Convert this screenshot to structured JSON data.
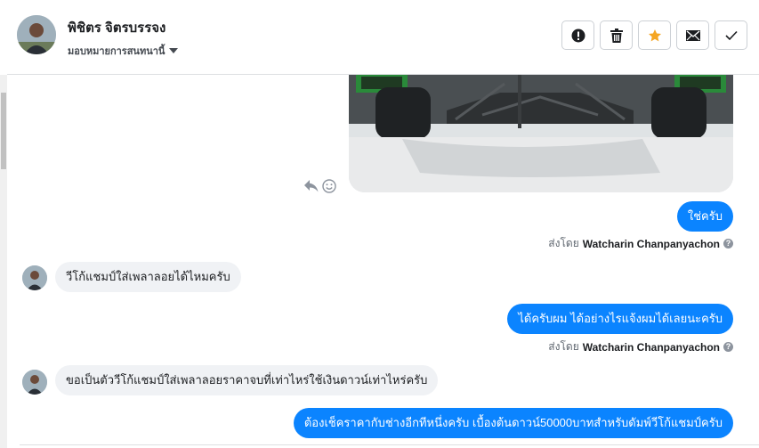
{
  "header": {
    "contact_name": "พิชิตร จิตรบรรจง",
    "assign_label": "มอบหมายการสนทนานี้",
    "actions": [
      {
        "name": "spam-button",
        "icon": "exclamation-icon"
      },
      {
        "name": "delete-button",
        "icon": "trash-icon"
      },
      {
        "name": "star-button",
        "icon": "star-icon"
      },
      {
        "name": "mark-unread-button",
        "icon": "envelope-icon"
      },
      {
        "name": "mark-done-button",
        "icon": "check-icon"
      }
    ]
  },
  "conversation": {
    "messages": [
      {
        "direction": "out",
        "text": "ใช่ครับ"
      },
      {
        "direction": "out_meta",
        "prefix": "ส่งโดย",
        "sender": "Watcharin Chanpanyachon"
      },
      {
        "direction": "in",
        "text": "วีโก้แชมป์ใส่เพลาลอยได้ไหมครับ"
      },
      {
        "direction": "out",
        "text": "ได้ครับผม ได้อย่างไรแจ้งผมได้เลยนะครับ"
      },
      {
        "direction": "out_meta",
        "prefix": "ส่งโดย",
        "sender": "Watcharin Chanpanyachon"
      },
      {
        "direction": "in",
        "text": "ขอเป็นตัววีโก้แชมป์ใส่เพลาลอยราคาจบที่เท่าไหร่ใช้เงินดาวน์เท่าไหร่ครับ"
      },
      {
        "direction": "out",
        "text": "ต้องเช็คราคากับช่างอีกทีหนึ่งครับ เบื้องต้นดาวน์50000บาทสำหรับดัมพ์วีโก้แชมป์ครับ"
      }
    ]
  },
  "colors": {
    "outgoing": "#0b84ff",
    "incoming": "#f0f2f5",
    "star": "#f5a623"
  }
}
